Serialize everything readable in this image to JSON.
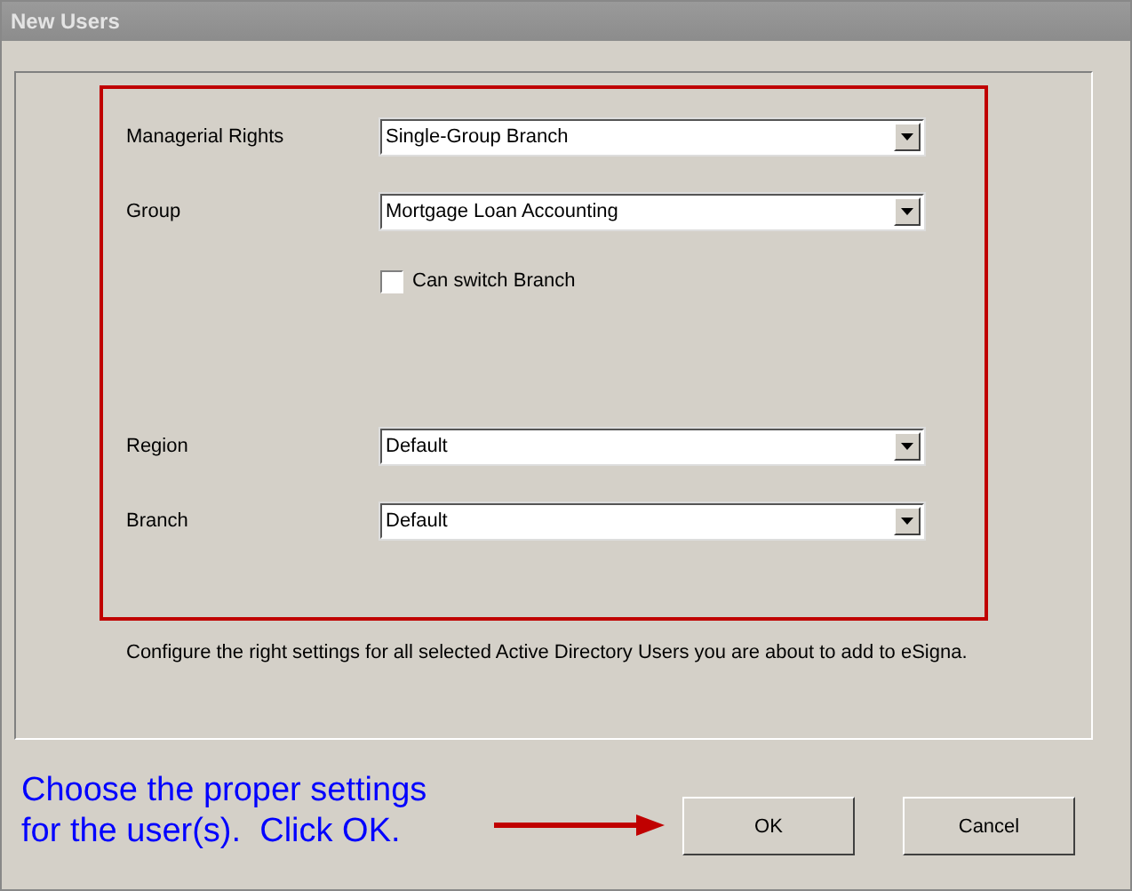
{
  "window": {
    "title": "New Users"
  },
  "fields": [
    {
      "kind": "select",
      "label": "Managerial Rights",
      "value": "Single-Group Branch"
    },
    {
      "kind": "select",
      "label": "Group",
      "value": "Mortgage Loan Accounting"
    },
    {
      "kind": "checkbox",
      "label": "Can switch Branch",
      "checked": false
    },
    {
      "kind": "select",
      "label": "Region",
      "value": "Default"
    },
    {
      "kind": "select",
      "label": "Branch",
      "value": "Default"
    }
  ],
  "note": "Configure the right settings for all selected Active Directory Users you are about to add to eSigna.",
  "annotation": [
    "Choose the proper settings",
    "for the user(s).  Click OK."
  ],
  "buttons": [
    "OK",
    "Cancel"
  ]
}
